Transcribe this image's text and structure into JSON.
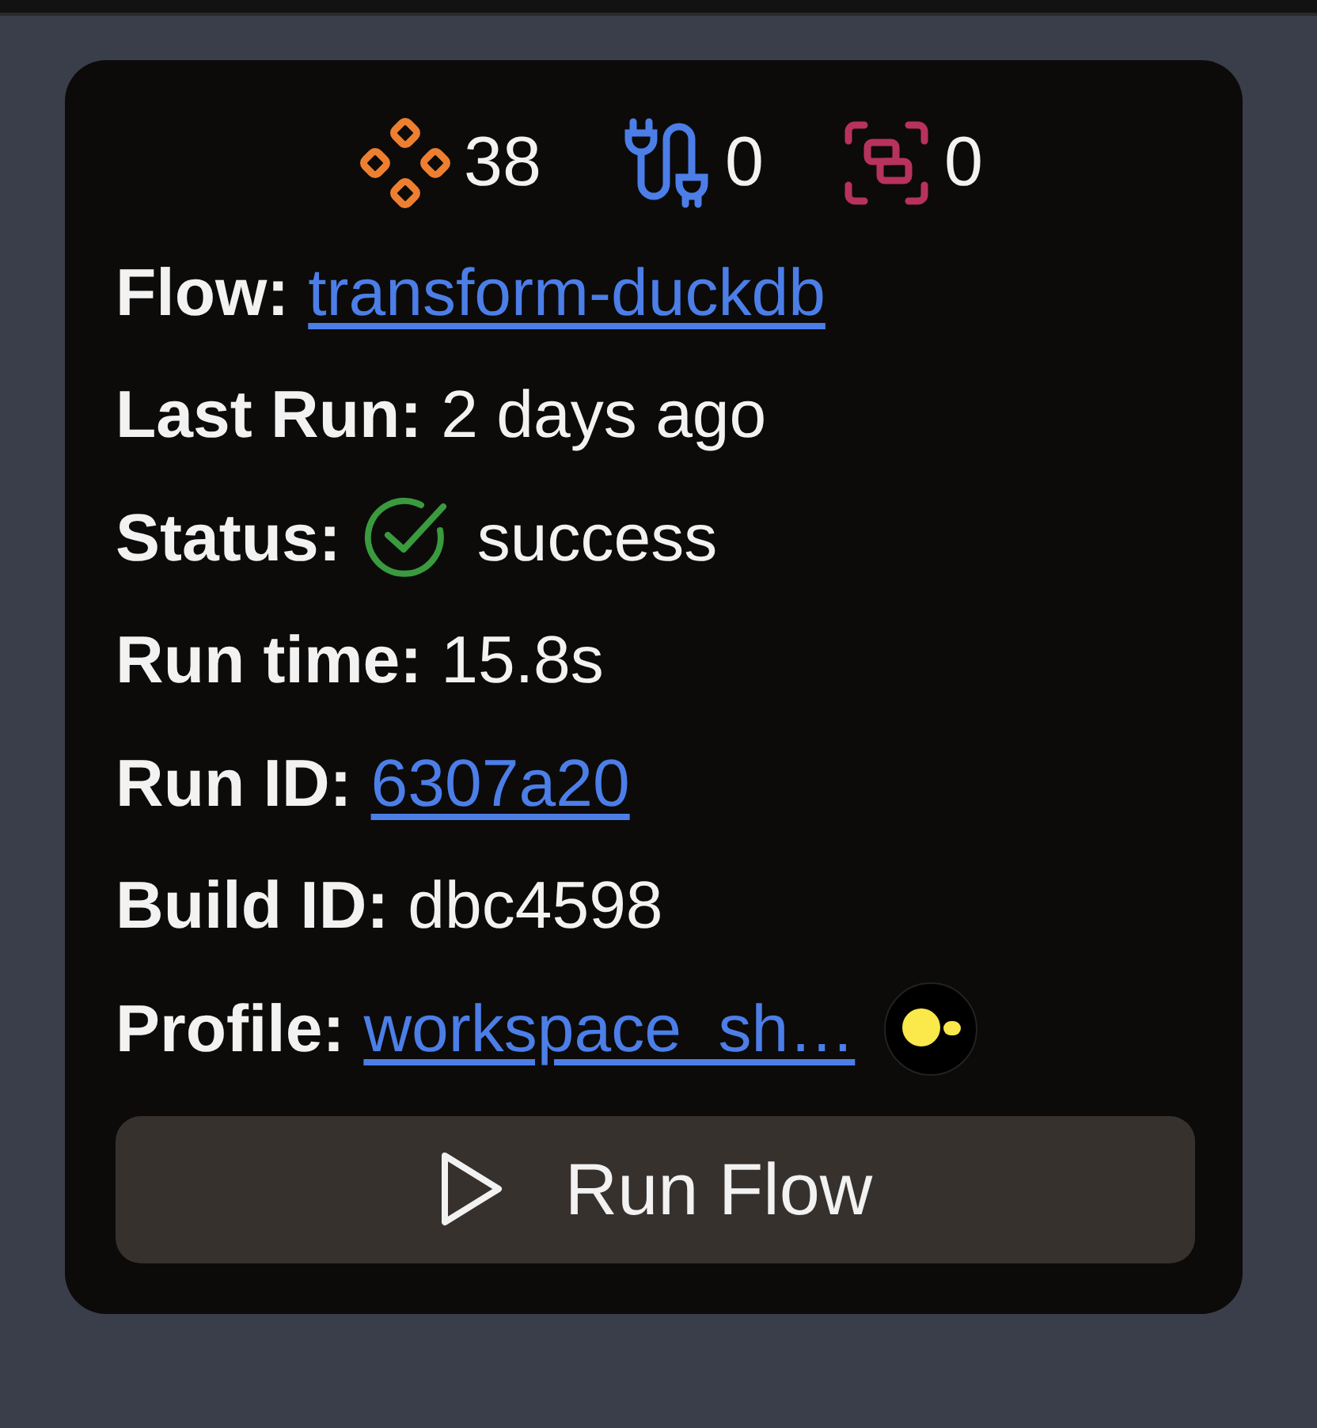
{
  "counters": [
    {
      "kind": "models",
      "value": "38",
      "color": "#ee7f30"
    },
    {
      "kind": "connections",
      "value": "0",
      "color": "#4c7ee8"
    },
    {
      "kind": "tests",
      "value": "0",
      "color": "#b8325e"
    }
  ],
  "fields": [
    {
      "kind": "link",
      "label": "Flow:",
      "value": "transform-duckdb"
    },
    {
      "kind": "text",
      "label": "Last Run:",
      "value": "2 days ago"
    },
    {
      "kind": "status",
      "label": "Status:",
      "value": "success",
      "success": true
    },
    {
      "kind": "text",
      "label": "Run time:",
      "value": "15.8s"
    },
    {
      "kind": "link",
      "label": "Run ID:",
      "value": "6307a20"
    },
    {
      "kind": "text",
      "label": "Build ID:",
      "value": "dbc4598"
    },
    {
      "kind": "profile",
      "label": "Profile:",
      "value": "workspace_sh…"
    }
  ],
  "run_button": {
    "label": "Run Flow"
  }
}
